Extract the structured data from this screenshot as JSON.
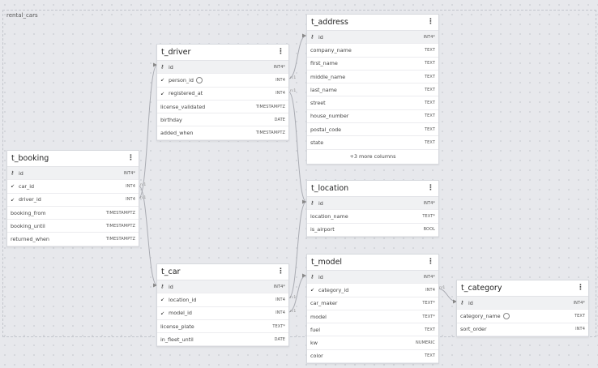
{
  "group": {
    "label": "rental_cars"
  },
  "tables": {
    "t_booking": {
      "name": "t_booking",
      "columns": [
        {
          "name": "id",
          "type": "INT4*",
          "icon": "key-icon"
        },
        {
          "name": "car_id",
          "type": "INT4",
          "icon": "fk-arrow-icon"
        },
        {
          "name": "driver_id",
          "type": "INT4",
          "icon": "fk-arrow-icon"
        },
        {
          "name": "booking_from",
          "type": "TIMESTAMPTZ",
          "icon": ""
        },
        {
          "name": "booking_until",
          "type": "TIMESTAMPTZ",
          "icon": ""
        },
        {
          "name": "returned_when",
          "type": "TIMESTAMPTZ",
          "icon": ""
        }
      ]
    },
    "t_driver": {
      "name": "t_driver",
      "columns": [
        {
          "name": "id",
          "type": "INT4*",
          "icon": "key-icon"
        },
        {
          "name": "person_id",
          "type": "INT4",
          "icon": "fk-arrow-icon",
          "note": true
        },
        {
          "name": "registered_at",
          "type": "INT4",
          "icon": "fk-arrow-icon"
        },
        {
          "name": "license_validated",
          "type": "TIMESTAMPTZ",
          "icon": ""
        },
        {
          "name": "birthday",
          "type": "DATE",
          "icon": ""
        },
        {
          "name": "added_when",
          "type": "TIMESTAMPTZ",
          "icon": ""
        }
      ]
    },
    "t_car": {
      "name": "t_car",
      "columns": [
        {
          "name": "id",
          "type": "INT4*",
          "icon": "key-icon"
        },
        {
          "name": "location_id",
          "type": "INT4",
          "icon": "fk-arrow-icon"
        },
        {
          "name": "model_id",
          "type": "INT4",
          "icon": "fk-arrow-icon"
        },
        {
          "name": "license_plate",
          "type": "TEXT*",
          "icon": ""
        },
        {
          "name": "in_fleet_until",
          "type": "DATE",
          "icon": ""
        }
      ]
    },
    "t_address": {
      "name": "t_address",
      "columns": [
        {
          "name": "id",
          "type": "INT4*",
          "icon": "key-icon"
        },
        {
          "name": "company_name",
          "type": "TEXT",
          "icon": ""
        },
        {
          "name": "first_name",
          "type": "TEXT",
          "icon": ""
        },
        {
          "name": "middle_name",
          "type": "TEXT",
          "icon": ""
        },
        {
          "name": "last_name",
          "type": "TEXT",
          "icon": ""
        },
        {
          "name": "street",
          "type": "TEXT",
          "icon": ""
        },
        {
          "name": "house_number",
          "type": "TEXT",
          "icon": ""
        },
        {
          "name": "postal_code",
          "type": "TEXT",
          "icon": ""
        },
        {
          "name": "state",
          "type": "TEXT",
          "icon": ""
        }
      ],
      "more": "+3 more columns"
    },
    "t_location": {
      "name": "t_location",
      "columns": [
        {
          "name": "id",
          "type": "INT4*",
          "icon": "key-icon"
        },
        {
          "name": "location_name",
          "type": "TEXT*",
          "icon": ""
        },
        {
          "name": "is_airport",
          "type": "BOOL",
          "icon": ""
        }
      ]
    },
    "t_model": {
      "name": "t_model",
      "columns": [
        {
          "name": "id",
          "type": "INT4*",
          "icon": "key-icon"
        },
        {
          "name": "category_id",
          "type": "INT4",
          "icon": "fk-arrow-icon"
        },
        {
          "name": "car_maker",
          "type": "TEXT*",
          "icon": ""
        },
        {
          "name": "model",
          "type": "TEXT*",
          "icon": ""
        },
        {
          "name": "fuel",
          "type": "TEXT",
          "icon": ""
        },
        {
          "name": "kw",
          "type": "NUMERIC",
          "icon": ""
        },
        {
          "name": "color",
          "type": "TEXT",
          "icon": ""
        }
      ]
    },
    "t_category": {
      "name": "t_category",
      "columns": [
        {
          "name": "id",
          "type": "INT4*",
          "icon": "key-icon"
        },
        {
          "name": "category_name",
          "type": "TEXT",
          "icon": "",
          "note": true
        },
        {
          "name": "sort_order",
          "type": "INT4",
          "icon": ""
        }
      ]
    }
  },
  "menu_glyph": "⋮",
  "key_glyph": "⚷",
  "fk_glyph": "↙",
  "cardinality": "n:1"
}
